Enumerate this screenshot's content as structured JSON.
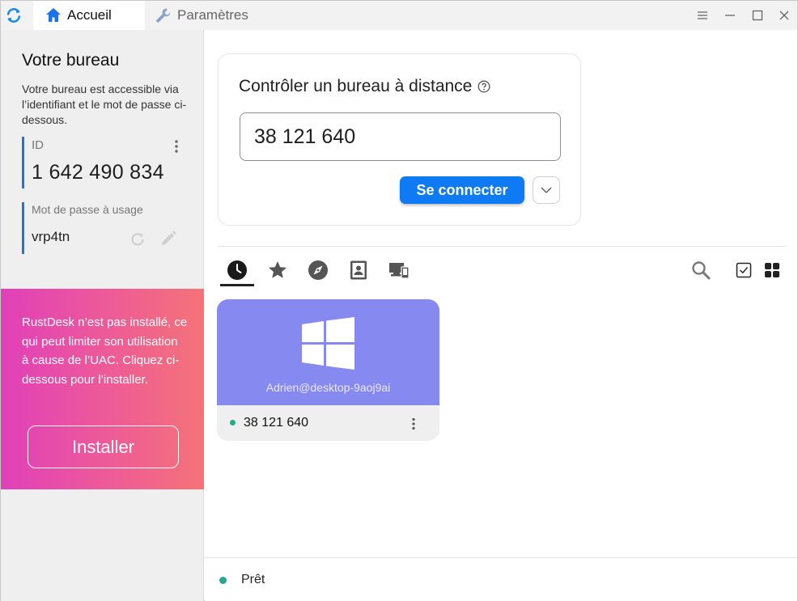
{
  "titlebar": {
    "tabs": [
      {
        "label": "Accueil",
        "icon": "home-icon",
        "active": true
      },
      {
        "label": "Paramètres",
        "icon": "wrench-icon",
        "active": false
      }
    ],
    "controls": [
      "menu-icon",
      "minimize-icon",
      "maximize-icon",
      "close-icon"
    ]
  },
  "left": {
    "title": "Votre bureau",
    "description": "Votre bureau est accessible via l’identifiant et le mot de passe ci-dessous.",
    "id_label": "ID",
    "id_value": "1 642 490 834",
    "password_label": "Mot de passe à usage",
    "password_value": "vrp4tn"
  },
  "promo": {
    "text": "RustDesk n’est pas installé, ce qui peut limiter son utilisation à cause de l’UAC. Cliquez ci-dessous pour l’installer.",
    "button_label": "Installer"
  },
  "connect": {
    "title": "Contrôler un bureau à distance",
    "input_value": "38 121 640",
    "button_label": "Se connecter"
  },
  "peer_tabs": [
    "recent-icon",
    "favorites-icon",
    "discovered-icon",
    "address-book-icon",
    "group-icon"
  ],
  "peers": [
    {
      "name": "Adrien@desktop-9aoj9ai",
      "id": "38 121 640",
      "os": "windows-logo-icon",
      "online": true
    }
  ],
  "status": {
    "text": "Prêt"
  },
  "colors": {
    "accent": "#0e7bf5",
    "online": "#27a78b",
    "peer_card": "#8689f0",
    "promo_start": "#e040b9",
    "promo_end": "#f47377"
  }
}
